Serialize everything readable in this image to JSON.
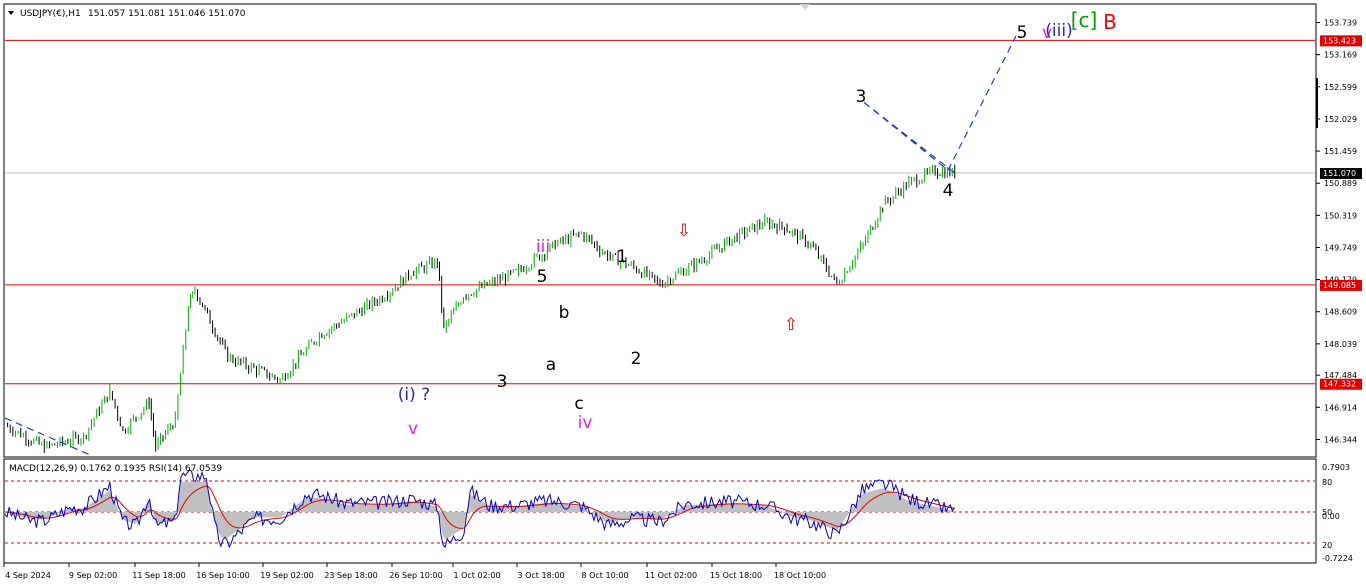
{
  "header": {
    "symbol": "USDJPY(€),H1",
    "ohlc": "151.057 151.081 151.046 151.070"
  },
  "indicator_title": "MACD(12,26,9) 0.1762 0.1935  RSI(14) 67.0539",
  "colors": {
    "bull": "#00b000",
    "bear": "#000000",
    "hline": "#e00000",
    "projection": "#1f3fbf",
    "macd_fill": "#c0c0c0",
    "signal": "#e00000",
    "rsi": "#0000cc",
    "wave_black": "#000000",
    "wave_magenta": "#e020e0",
    "wave_blue": "#2828c8",
    "wave_green": "#00a000",
    "wave_red": "#ff0000"
  },
  "chart_data": {
    "type": "candlestick",
    "symbol": "USDJPY",
    "timeframe": "H1",
    "ylim": [
      146.05,
      154.05
    ],
    "price_ticks": [
      "153.739",
      "153.169",
      "152.599",
      "152.029",
      "151.459",
      "150.889",
      "150.319",
      "149.749",
      "149.179",
      "148.609",
      "148.039",
      "147.484",
      "146.914",
      "146.344"
    ],
    "x_labels": [
      "4 Sep 2024",
      "9 Sep 02:00",
      "11 Sep 18:00",
      "16 Sep 10:00",
      "19 Sep 02:00",
      "23 Sep 18:00",
      "26 Sep 10:00",
      "1 Oct 02:00",
      "3 Oct 18:00",
      "8 Oct 10:00",
      "11 Oct 02:00",
      "15 Oct 18:00",
      "18 Oct 10:00"
    ],
    "current_price": 151.07,
    "horizontal_levels": [
      153.423,
      149.085,
      147.332
    ],
    "price_path": [
      [
        0.0,
        146.6
      ],
      [
        0.03,
        146.2
      ],
      [
        0.06,
        146.4
      ],
      [
        0.08,
        147.2
      ],
      [
        0.09,
        146.5
      ],
      [
        0.11,
        147.0
      ],
      [
        0.115,
        146.2
      ],
      [
        0.13,
        146.7
      ],
      [
        0.14,
        148.7
      ],
      [
        0.145,
        149.0
      ],
      [
        0.17,
        147.8
      ],
      [
        0.21,
        147.4
      ],
      [
        0.24,
        148.2
      ],
      [
        0.255,
        148.4
      ],
      [
        0.29,
        148.9
      ],
      [
        0.31,
        149.3
      ],
      [
        0.33,
        149.5
      ],
      [
        0.335,
        148.3
      ],
      [
        0.35,
        148.9
      ],
      [
        0.39,
        149.3
      ],
      [
        0.42,
        149.8
      ],
      [
        0.44,
        150.0
      ],
      [
        0.46,
        149.6
      ],
      [
        0.48,
        149.4
      ],
      [
        0.5,
        149.1
      ],
      [
        0.53,
        149.5
      ],
      [
        0.555,
        149.9
      ],
      [
        0.58,
        150.2
      ],
      [
        0.595,
        150.1
      ],
      [
        0.615,
        149.8
      ],
      [
        0.635,
        149.1
      ],
      [
        0.655,
        149.8
      ],
      [
        0.67,
        150.5
      ],
      [
        0.69,
        150.9
      ],
      [
        0.71,
        151.1
      ],
      [
        0.725,
        151.07
      ]
    ],
    "projection": [
      [
        151.07,
        151.07
      ],
      [
        152.35,
        152.35
      ],
      [
        151.12,
        151.12
      ],
      [
        153.5,
        153.5
      ]
    ],
    "wave_labels": [
      {
        "text": "5",
        "price": 153.6
      },
      {
        "text": "v",
        "price": 153.6
      },
      {
        "text": "(iii)",
        "price": 153.6
      },
      {
        "text": "[c]",
        "price": 153.6
      },
      {
        "text": "B",
        "price": 153.6
      },
      {
        "text": "3",
        "price": 152.55
      },
      {
        "text": "4",
        "price": 150.95
      },
      {
        "text": "⇩",
        "price": 150.2
      },
      {
        "text": "⇧",
        "price": 148.65
      },
      {
        "text": "iii",
        "price": 150.0
      },
      {
        "text": "5",
        "price": 149.4
      },
      {
        "text": "1",
        "price": 149.8
      },
      {
        "text": "b",
        "price": 148.7
      },
      {
        "text": "2",
        "price": 148.0
      },
      {
        "text": "a",
        "price": 147.9
      },
      {
        "text": "3",
        "price": 147.55
      },
      {
        "text": "(i) ?",
        "price": 147.4
      },
      {
        "text": "c",
        "price": 147.2
      },
      {
        "text": "iv",
        "price": 146.9
      },
      {
        "text": "v",
        "price": 146.8
      }
    ],
    "indicator": {
      "name": "MACD(12,26,9) + RSI(14)",
      "macd": 0.1762,
      "signal": 0.1935,
      "rsi": 67.0539,
      "axis_labels": [
        "0.7903",
        "80",
        "50",
        "0.00",
        "20",
        "-0.7224"
      ]
    }
  }
}
